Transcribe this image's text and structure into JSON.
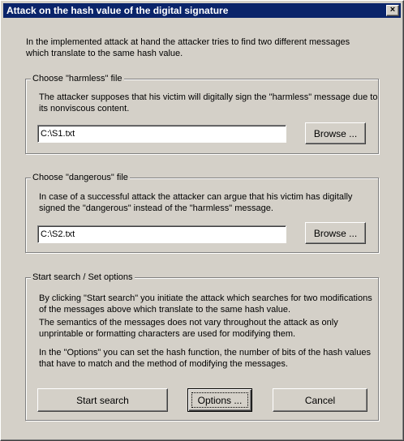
{
  "window": {
    "title": "Attack on the hash value of the digital signature",
    "close_glyph": "×"
  },
  "intro": {
    "line1": "In the implemented attack at hand the attacker tries to find two different messages",
    "line2": "which translate to the same hash value."
  },
  "harmless": {
    "label": "Choose \"harmless\" file",
    "desc1": "The attacker supposes that his victim will digitally sign the \"harmless\" message due to",
    "desc2": "its nonviscous content.",
    "path": "C:\\S1.txt",
    "browse_label": "Browse ..."
  },
  "dangerous": {
    "label": "Choose \"dangerous\" file",
    "desc1": "In case of a successful attack the attacker can argue that his victim has digitally",
    "desc2": "signed the \"dangerous\" instead of the \"harmless\" message.",
    "path": "C:\\S2.txt",
    "browse_label": "Browse ..."
  },
  "search": {
    "label": "Start search / Set options",
    "p1_line1": "By clicking \"Start search\" you initiate the attack which searches for two modifications",
    "p1_line2": "of the messages above which translate to the same hash value.",
    "p2_line1": "The semantics of the messages does not vary throughout the attack as only",
    "p2_line2": "unprintable or formatting characters are used for modifying them.",
    "p3_line1": "In the \"Options\" you can set the hash function, the number of bits of the hash values",
    "p3_line2": "that have to match and the method of modifying the messages.",
    "start_label": "Start search",
    "options_label": "Options ...",
    "cancel_label": "Cancel"
  }
}
